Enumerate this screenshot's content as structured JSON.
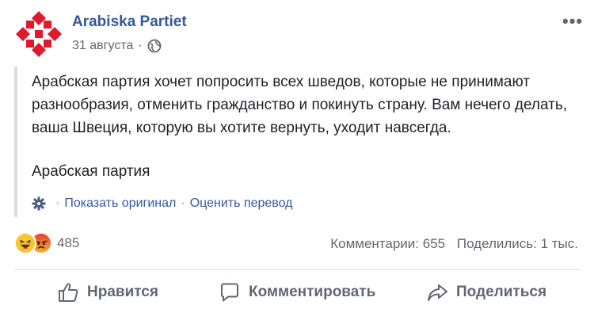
{
  "post": {
    "page_name": "Arabiska Partiet",
    "date": "31 августа",
    "audience_icon": "globe-icon",
    "more_icon": "more-options-icon",
    "text": "Арабская партия хочет попросить всех шведов, которые не принимают разнообразия, отменить гражданство и покинуть страну. Вам нечего делать, ваша Швеция, которую вы хотите вернуть, уходит навсегда.",
    "signature": "Арабская партия"
  },
  "translation": {
    "show_original": "Показать оригинал",
    "rate_translation": "Оценить перевод"
  },
  "reactions": {
    "types": [
      "haha",
      "angry"
    ],
    "count": "485"
  },
  "stats": {
    "comments": "Комментарии: 655",
    "shares": "Поделились: 1 тыс."
  },
  "actions": {
    "like": "Нравится",
    "comment": "Комментировать",
    "share": "Поделиться"
  },
  "colors": {
    "link": "#365899",
    "secondary_text": "#606770",
    "logo_red": "#e0192d",
    "divider": "#dadde1"
  }
}
